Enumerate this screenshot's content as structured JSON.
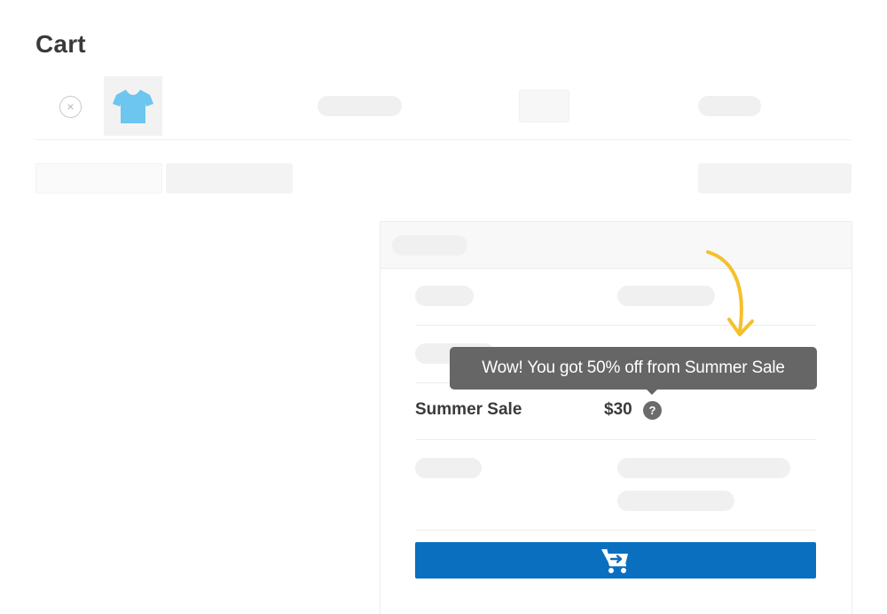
{
  "page": {
    "title": "Cart"
  },
  "cart_item": {
    "remove_glyph": "×",
    "thumbnail_icon": "tshirt-icon",
    "thumbnail_color": "#6cc6ef"
  },
  "totals": {
    "discount_row": {
      "label": "Summer Sale",
      "value": "$30",
      "help_glyph": "?"
    },
    "tooltip": {
      "text": "Wow! You got 50% off from Summer Sale"
    },
    "checkout_button": {
      "icon": "cart-arrow-icon",
      "color": "#0b6fc0"
    }
  },
  "annotation": {
    "arrow_color": "#f5c02a"
  }
}
